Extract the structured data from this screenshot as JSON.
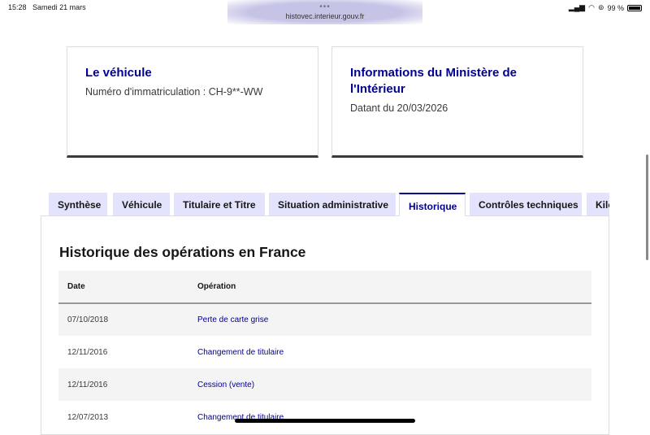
{
  "status_bar": {
    "time": "15:28",
    "date": "Samedi 21 mars",
    "url": "histovec.interieur.gouv.fr",
    "battery": "99 %"
  },
  "cards": [
    {
      "title": "Le véhicule",
      "text": "Numéro d'immatriculation : CH-9**-WW"
    },
    {
      "title": "Informations du Ministère de l'Intérieur",
      "text": "Datant du 20/03/2026"
    }
  ],
  "tabs": [
    {
      "label": "Synthèse"
    },
    {
      "label": "Véhicule"
    },
    {
      "label": "Titulaire et Titre"
    },
    {
      "label": "Situation administrative"
    },
    {
      "label": "Historique",
      "active": true
    },
    {
      "label": "Contrôles techniques"
    },
    {
      "label": "Kilométrage"
    }
  ],
  "history": {
    "title": "Historique des opérations en France",
    "headers": [
      "Date",
      "Opération"
    ],
    "rows": [
      {
        "date": "07/10/2018",
        "operation": "Perte de carte grise"
      },
      {
        "date": "12/11/2016",
        "operation": "Changement de titulaire"
      },
      {
        "date": "12/11/2016",
        "operation": "Cession (vente)"
      },
      {
        "date": "12/07/2013",
        "operation": "Changement de titulaire"
      }
    ]
  }
}
